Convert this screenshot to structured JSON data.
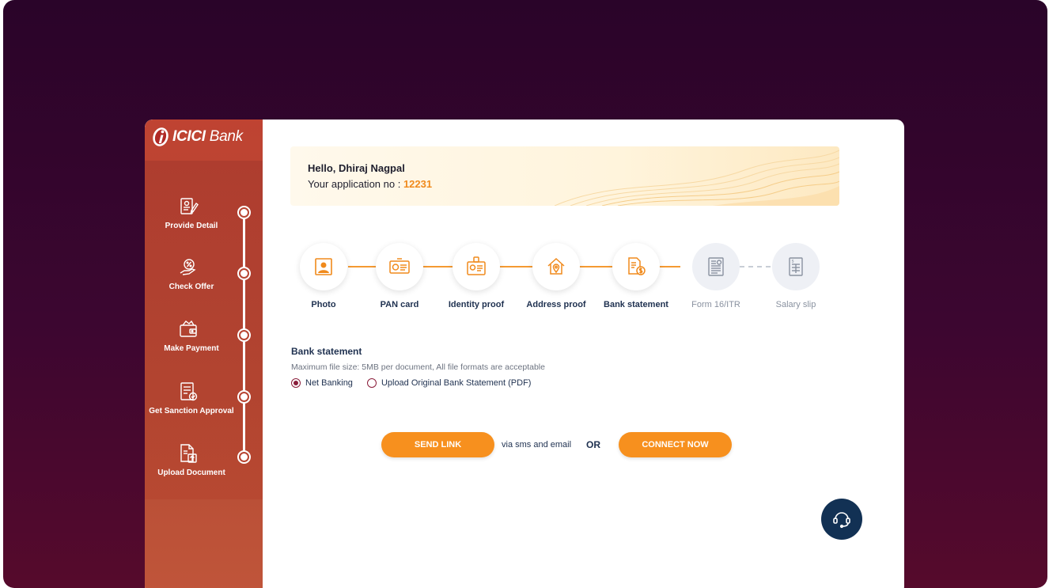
{
  "brand": {
    "name_bold": "ICICI",
    "name_light": "Bank",
    "primary_color": "#b84532",
    "accent_color": "#f7901e",
    "backdrop_color": "#3c0630"
  },
  "sidebar": {
    "steps": [
      {
        "label": "Provide Detail",
        "icon": "form-edit-icon"
      },
      {
        "label": "Check Offer",
        "icon": "percent-hand-icon"
      },
      {
        "label": "Make Payment",
        "icon": "wallet-icon"
      },
      {
        "label": "Get Sanction Approval",
        "icon": "checklist-approve-icon"
      },
      {
        "label": "Upload Document",
        "icon": "document-upload-icon"
      }
    ]
  },
  "greeting": {
    "hello": "Hello, Dhiraj Nagpal",
    "app_prefix": "Your application no : ",
    "app_number": "12231"
  },
  "documents": [
    {
      "label": "Photo",
      "icon": "photo-icon",
      "state": "active"
    },
    {
      "label": "PAN card",
      "icon": "pan-card-icon",
      "state": "active"
    },
    {
      "label": "Identity proof",
      "icon": "id-badge-icon",
      "state": "active"
    },
    {
      "label": "Address proof",
      "icon": "house-location-icon",
      "state": "active"
    },
    {
      "label": "Bank statement",
      "icon": "statement-dollar-icon",
      "state": "active"
    },
    {
      "label": "Form 16/ITR",
      "icon": "form16-icon",
      "state": "inactive"
    },
    {
      "label": "Salary slip",
      "icon": "salary-slip-icon",
      "state": "inactive"
    }
  ],
  "bank_statement": {
    "title": "Bank statement",
    "help": "Maximum file size: 5MB per document, All file formats are acceptable",
    "options": [
      {
        "label": "Net Banking",
        "selected": true
      },
      {
        "label": "Upload Original Bank Statement (PDF)",
        "selected": false
      }
    ]
  },
  "actions": {
    "send_link": "SEND LINK",
    "via_text": "via sms and email",
    "or_text": "OR",
    "connect_now": "CONNECT NOW"
  },
  "support": {
    "icon": "headset-icon"
  }
}
